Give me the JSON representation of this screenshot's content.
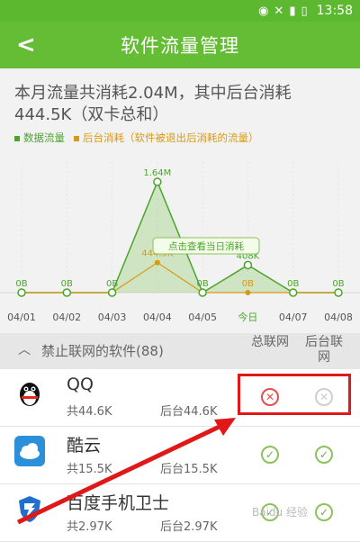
{
  "status": {
    "time": "13:58",
    "icons": [
      "wifi-icon",
      "no-sim-icon",
      "signal-icon",
      "battery-icon"
    ]
  },
  "header": {
    "title": "软件流量管理",
    "back_glyph": "<"
  },
  "summary": {
    "text": "本月流量共消耗2.04M，其中后台消耗444.5K（双卡总和）"
  },
  "legend": {
    "data": "数据流量",
    "background": "后台消耗（软件被退出后消耗的流量）"
  },
  "chart_data": {
    "type": "line",
    "categories": [
      "04/01",
      "04/02",
      "04/03",
      "04/04",
      "04/05",
      "今日",
      "04/07",
      "04/08"
    ],
    "series": [
      {
        "name": "数据流量",
        "values": [
          0,
          0,
          0,
          1640,
          0,
          408,
          0,
          0
        ],
        "labels": [
          "0B",
          "0B",
          "0B",
          "1.64M",
          "0B",
          "408K",
          "0B",
          "0B"
        ],
        "color": "#4aa62a"
      },
      {
        "name": "后台消耗",
        "values": [
          0,
          0,
          0,
          444.5,
          0,
          0,
          0,
          0
        ],
        "labels": [
          "",
          "",
          "",
          "444.5K",
          "",
          "0B",
          "",
          ""
        ],
        "color": "#d99a12"
      }
    ],
    "tooltip": "点击查看当日消耗",
    "grid": false
  },
  "section": {
    "title": "禁止联网的软件(88)",
    "col_total": "总联网",
    "col_background": "后台联网"
  },
  "apps": [
    {
      "name": "QQ",
      "total": "共44.6K",
      "background": "后台44.6K",
      "total_state": "blocked",
      "background_state": "disabled"
    },
    {
      "name": "酷云",
      "total": "共15.5K",
      "background": "后台15.5K",
      "total_state": "allowed",
      "background_state": "allowed"
    },
    {
      "name": "百度手机卫士",
      "total": "共2.97K",
      "background": "后台2.97K",
      "total_state": "allowed",
      "background_state": "allowed"
    }
  ],
  "watermark": "Baidu 经验",
  "colors": {
    "header": "#64bd35",
    "accent_green": "#4aa62a",
    "accent_orange": "#d99a12",
    "highlight": "#e01818"
  }
}
